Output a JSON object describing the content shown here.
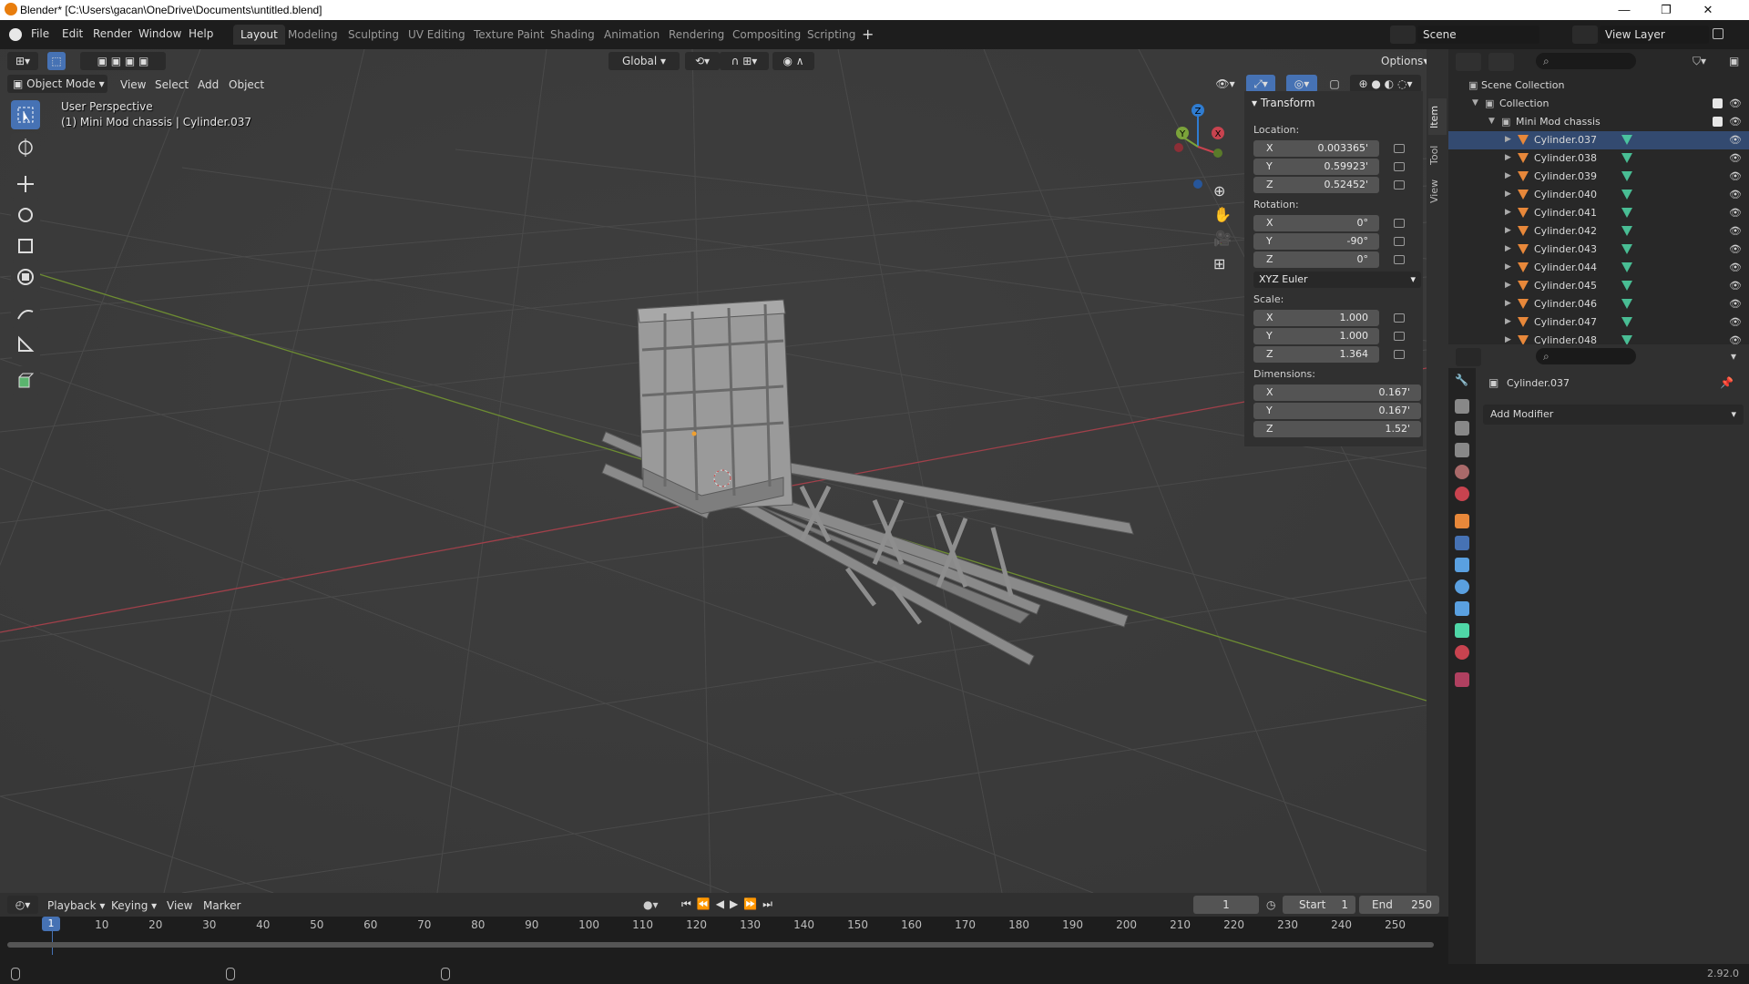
{
  "window": {
    "title": "Blender* [C:\\Users\\gacan\\OneDrive\\Documents\\untitled.blend]",
    "controls": [
      "—",
      "❐",
      "✕"
    ]
  },
  "menu": {
    "items": [
      "File",
      "Edit",
      "Render",
      "Window",
      "Help"
    ]
  },
  "workspaces": {
    "tabs": [
      "Layout",
      "Modeling",
      "Sculpting",
      "UV Editing",
      "Texture Paint",
      "Shading",
      "Animation",
      "Rendering",
      "Compositing",
      "Scripting"
    ],
    "add": "+"
  },
  "scene": {
    "name": "Scene",
    "view_layer": "View Layer"
  },
  "viewport_header": {
    "transform_orientation": "Global",
    "options_label": "Options",
    "mode": "Object Mode",
    "menus": [
      "View",
      "Select",
      "Add",
      "Object"
    ]
  },
  "viewport": {
    "perspective": "User Perspective",
    "object_info": "(1) Mini Mod chassis | Cylinder.037",
    "gizmo": {
      "x": "X",
      "y": "Y",
      "z": "Z"
    }
  },
  "side_tabs": [
    "Item",
    "Tool",
    "View"
  ],
  "npanel": {
    "header": "Transform",
    "location_label": "Location:",
    "location": [
      {
        "axis": "X",
        "value": "0.003365'"
      },
      {
        "axis": "Y",
        "value": "0.59923'"
      },
      {
        "axis": "Z",
        "value": "0.52452'"
      }
    ],
    "rotation_label": "Rotation:",
    "rotation": [
      {
        "axis": "X",
        "value": "0°"
      },
      {
        "axis": "Y",
        "value": "-90°"
      },
      {
        "axis": "Z",
        "value": "0°"
      }
    ],
    "rotation_mode": "XYZ Euler",
    "scale_label": "Scale:",
    "scale": [
      {
        "axis": "X",
        "value": "1.000"
      },
      {
        "axis": "Y",
        "value": "1.000"
      },
      {
        "axis": "Z",
        "value": "1.364"
      }
    ],
    "dimensions_label": "Dimensions:",
    "dimensions": [
      {
        "axis": "X",
        "value": "0.167'"
      },
      {
        "axis": "Y",
        "value": "0.167'"
      },
      {
        "axis": "Z",
        "value": "1.52'"
      }
    ]
  },
  "outliner": {
    "root": "Scene Collection",
    "collection": "Collection",
    "group": "Mini Mod chassis",
    "objects": [
      "Cylinder.037",
      "Cylinder.038",
      "Cylinder.039",
      "Cylinder.040",
      "Cylinder.041",
      "Cylinder.042",
      "Cylinder.043",
      "Cylinder.044",
      "Cylinder.045",
      "Cylinder.046",
      "Cylinder.047",
      "Cylinder.048"
    ]
  },
  "properties": {
    "object_name": "Cylinder.037",
    "add_modifier": "Add Modifier"
  },
  "timeline": {
    "menus": [
      "Playback",
      "Keying",
      "View",
      "Marker"
    ],
    "current_frame": "1",
    "start_label": "Start",
    "start": "1",
    "end_label": "End",
    "end": "250",
    "ticks": [
      "10",
      "20",
      "30",
      "40",
      "50",
      "60",
      "70",
      "80",
      "90",
      "100",
      "110",
      "120",
      "130",
      "140",
      "150",
      "160",
      "170",
      "180",
      "190",
      "200",
      "210",
      "220",
      "230",
      "240",
      "250"
    ],
    "playhead": "1"
  },
  "status": {
    "version": "2.92.0"
  },
  "colors": {
    "accent": "#4672b4",
    "object_orange": "#e8883a",
    "mesh_green": "#4fd7a7",
    "x_axis": "#c8434f",
    "y_axis": "#7ba33a",
    "z_axis": "#2f7cd1"
  }
}
